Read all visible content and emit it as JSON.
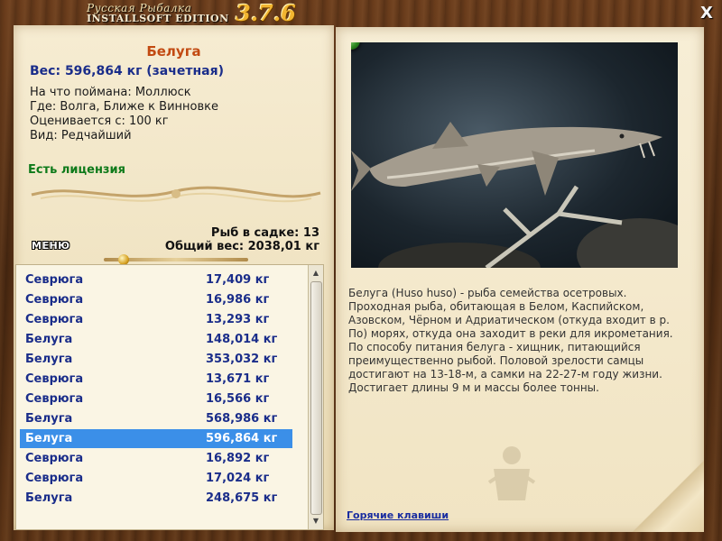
{
  "app": {
    "logo_line1": "Русская Рыбалка",
    "logo_line2": "INSTALLSOFT EDITION",
    "version": "3.7.6",
    "close_label": "X"
  },
  "fish": {
    "name": "Белуга",
    "weight_line": "Вес: 596,864 кг (зачетная)",
    "caught_on": "На что поймана: Моллюск",
    "location": "Где: Волга, Ближе к Винновке",
    "value": "Оценивается с: 100 кг",
    "rarity": "Вид: Редчайший",
    "license": "Есть лицензия"
  },
  "stats": {
    "count": "Рыб в садке: 13",
    "total_weight": "Общий вес: 2038,01 кг"
  },
  "menu_label": "МЕНЮ",
  "catch_list": [
    {
      "name": "Севрюга",
      "weight": "17,409 кг",
      "selected": false
    },
    {
      "name": "Севрюга",
      "weight": "16,986 кг",
      "selected": false
    },
    {
      "name": "Севрюга",
      "weight": "13,293 кг",
      "selected": false
    },
    {
      "name": "Белуга",
      "weight": "148,014 кг",
      "selected": false
    },
    {
      "name": "Белуга",
      "weight": "353,032 кг",
      "selected": false
    },
    {
      "name": "Севрюга",
      "weight": "13,671 кг",
      "selected": false
    },
    {
      "name": "Севрюга",
      "weight": "16,566 кг",
      "selected": false
    },
    {
      "name": "Белуга",
      "weight": "568,986 кг",
      "selected": false
    },
    {
      "name": "Белуга",
      "weight": "596,864 кг",
      "selected": true
    },
    {
      "name": "Севрюга",
      "weight": "16,892 кг",
      "selected": false
    },
    {
      "name": "Севрюга",
      "weight": "17,024 кг",
      "selected": false
    },
    {
      "name": "Белуга",
      "weight": "248,675 кг",
      "selected": false
    }
  ],
  "description": "Белуга (Huso huso) - рыба семейства осетровых. Проходная рыба, обитающая в Белом, Каспийском, Азовском, Чёрном и Адриатическом (откуда входит в р. По) морях, откуда она заходит в реки для икрометания. По способу питания белуга - хищник, питающийся преимущественно рыбой. Половой зрелости самцы достигают на 13-18-м, а самки на 22-27-м году жизни. Достигает длины 9 м и массы более тонны.",
  "hotkeys_label": "Горячие клавиши",
  "colors": {
    "selected_row": "#3b8fe8",
    "list_text": "#1a2d8a",
    "fish_name": "#c24a12",
    "license": "#0e7a1a"
  }
}
